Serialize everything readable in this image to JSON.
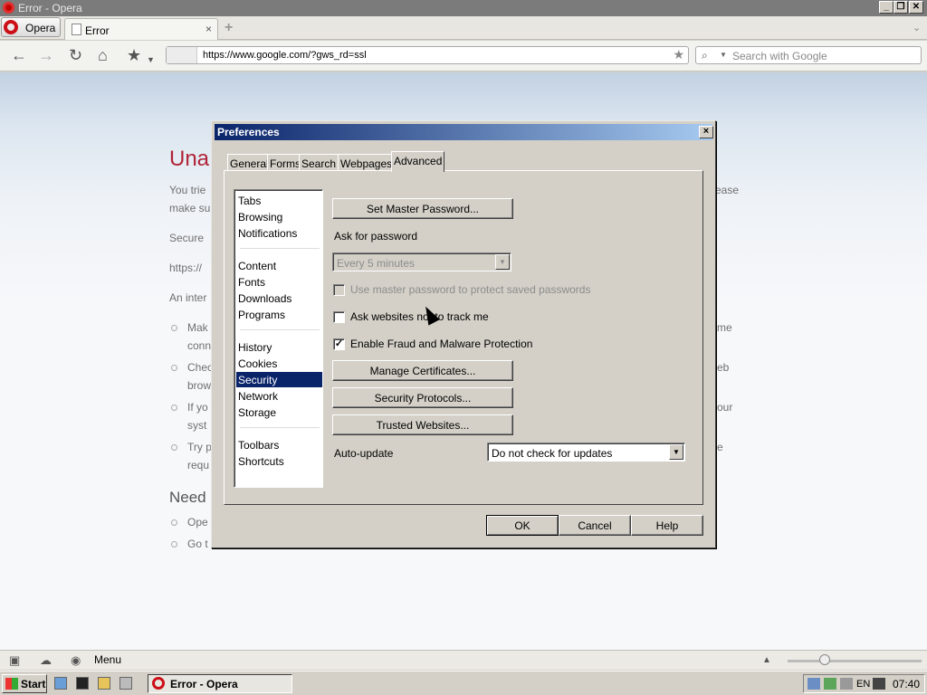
{
  "window": {
    "title": "Error - Opera"
  },
  "tabstrip": {
    "opera_label": "Opera",
    "tab_label": "Error",
    "tab_close": "×",
    "new_tab": "+"
  },
  "toolbar": {
    "url": "https://www.google.com/?gws_rd=ssl",
    "search_placeholder": "Search with Google"
  },
  "page": {
    "heading": "Una",
    "p1a": "You trie",
    "p1b": "make su",
    "p1c": "ease",
    "secure": "Secure",
    "url_line": "https://",
    "internet": "An inter",
    "bullets": [
      {
        "a": "Mak",
        "b": "conn",
        "c": "me"
      },
      {
        "a": "Chec",
        "b": "brow",
        "c": "eb"
      },
      {
        "a": "If yo",
        "b": "syst",
        "c": "our"
      },
      {
        "a": "Try p",
        "b": "requ",
        "c": "e"
      }
    ],
    "need": "Need",
    "need_items": [
      "Ope",
      "Go t"
    ]
  },
  "dialog": {
    "title": "Preferences",
    "close": "×",
    "tabs": [
      "General",
      "Forms",
      "Search",
      "Webpages",
      "Advanced"
    ],
    "sections": [
      [
        "Tabs",
        "Browsing",
        "Notifications"
      ],
      [
        "Content",
        "Fonts",
        "Downloads",
        "Programs"
      ],
      [
        "History",
        "Cookies",
        "Security",
        "Network",
        "Storage"
      ],
      [
        "Toolbars",
        "Shortcuts"
      ]
    ],
    "selected_section": "Security",
    "set_master_password": "Set Master Password...",
    "ask_for_password": "Ask for password",
    "ask_interval": "Every 5 minutes",
    "use_master_password": "Use master password to protect saved passwords",
    "do_not_track": "Ask websites not to track me",
    "fraud_protection": "Enable Fraud and Malware Protection",
    "manage_certificates": "Manage Certificates...",
    "security_protocols": "Security Protocols...",
    "trusted_websites": "Trusted Websites...",
    "auto_update_label": "Auto-update",
    "auto_update_value": "Do not check for updates",
    "ok": "OK",
    "cancel": "Cancel",
    "help": "Help",
    "checks": {
      "use_master_password": false,
      "do_not_track": false,
      "fraud_protection": true
    }
  },
  "statusbar": {
    "menu": "Menu"
  },
  "taskbar": {
    "start": "Start",
    "task": "Error - Opera",
    "lang": "EN",
    "clock": "07:40"
  }
}
